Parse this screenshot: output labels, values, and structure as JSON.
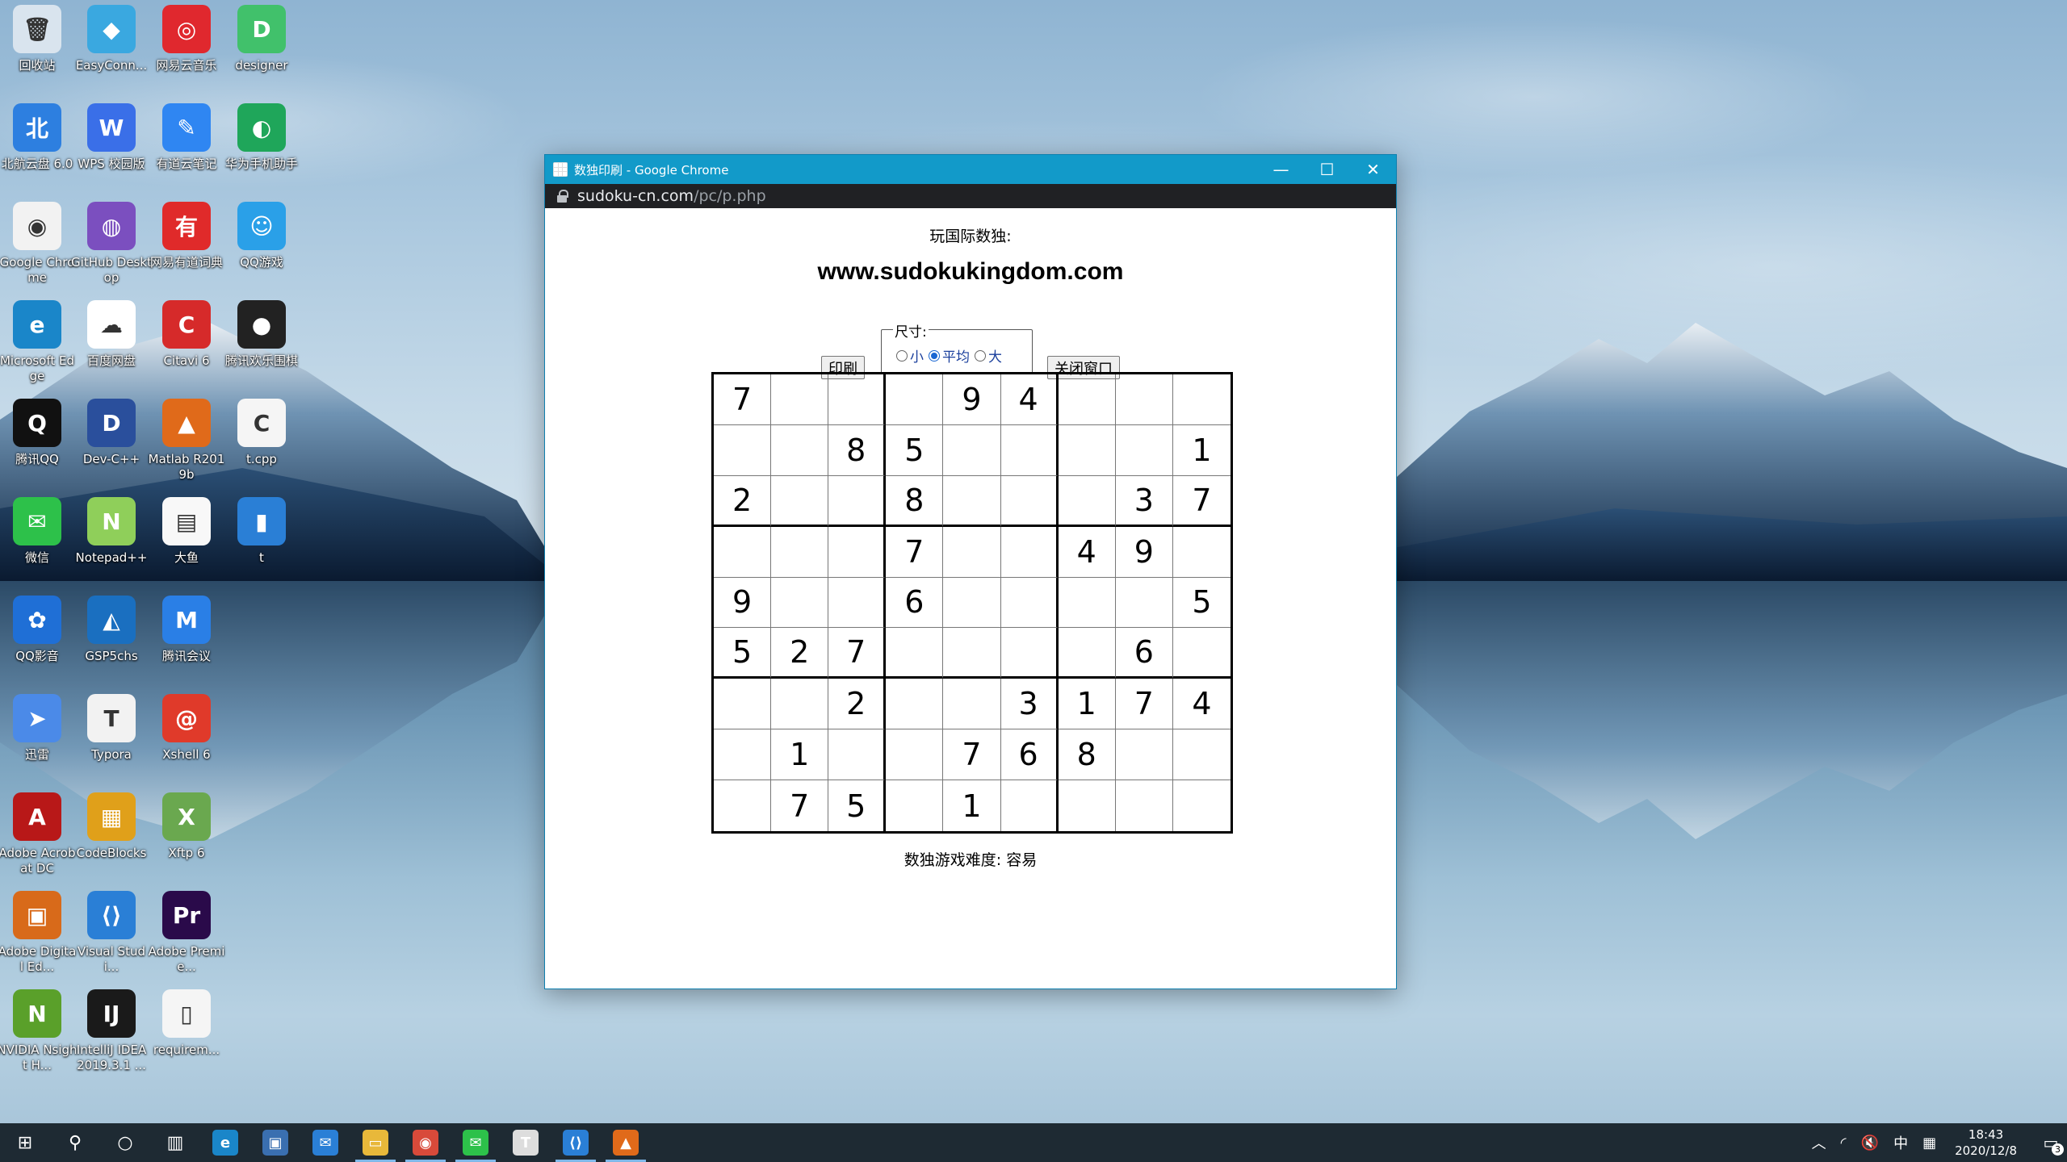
{
  "desktop": {
    "icons": [
      {
        "label": "回收站",
        "color": "#d9e4ee",
        "glyph": "🗑",
        "col": 0,
        "row": 0
      },
      {
        "label": "EasyConn...",
        "color": "#3aa8e0",
        "glyph": "◆",
        "col": 1,
        "row": 0
      },
      {
        "label": "网易云音乐",
        "color": "#e0282e",
        "glyph": "◎",
        "col": 2,
        "row": 0
      },
      {
        "label": "designer",
        "color": "#41c16b",
        "glyph": "D",
        "col": 3,
        "row": 0
      },
      {
        "label": "北航云盘 6.0",
        "color": "#2d7fe0",
        "glyph": "北",
        "col": 0,
        "row": 1
      },
      {
        "label": "WPS 校园版",
        "color": "#3a6fe8",
        "glyph": "W",
        "col": 1,
        "row": 1
      },
      {
        "label": "有道云笔记",
        "color": "#2f86f2",
        "glyph": "✎",
        "col": 2,
        "row": 1
      },
      {
        "label": "华为手机助手",
        "color": "#1fa65a",
        "glyph": "◐",
        "col": 3,
        "row": 1
      },
      {
        "label": "Google Chrome",
        "color": "#f2f2f2",
        "glyph": "◉",
        "col": 0,
        "row": 2
      },
      {
        "label": "GitHub Desktop",
        "color": "#7b4fbf",
        "glyph": "◍",
        "col": 1,
        "row": 2
      },
      {
        "label": "网易有道词典",
        "color": "#e02a2a",
        "glyph": "有",
        "col": 2,
        "row": 2
      },
      {
        "label": "QQ游戏",
        "color": "#2aa0e8",
        "glyph": "☺",
        "col": 3,
        "row": 2
      },
      {
        "label": "Microsoft Edge",
        "color": "#1a86c9",
        "glyph": "e",
        "col": 0,
        "row": 3
      },
      {
        "label": "百度网盘",
        "color": "#ffffff",
        "glyph": "☁",
        "col": 1,
        "row": 3
      },
      {
        "label": "Citavi 6",
        "color": "#d62a2a",
        "glyph": "C",
        "col": 2,
        "row": 3
      },
      {
        "label": "腾讯欢乐围棋",
        "color": "#222222",
        "glyph": "●",
        "col": 3,
        "row": 3
      },
      {
        "label": "腾讯QQ",
        "color": "#111111",
        "glyph": "Q",
        "col": 0,
        "row": 4
      },
      {
        "label": "Dev-C++",
        "color": "#2a4f9c",
        "glyph": "D",
        "col": 1,
        "row": 4
      },
      {
        "label": "Matlab R2019b",
        "color": "#e06a1a",
        "glyph": "▲",
        "col": 2,
        "row": 4
      },
      {
        "label": "t.cpp",
        "color": "#f5f5f5",
        "glyph": "C",
        "col": 3,
        "row": 4
      },
      {
        "label": "微信",
        "color": "#2dc14a",
        "glyph": "✉",
        "col": 0,
        "row": 5
      },
      {
        "label": "Notepad++",
        "color": "#8fcf5a",
        "glyph": "N",
        "col": 1,
        "row": 5
      },
      {
        "label": "大鱼",
        "color": "#f8f8f8",
        "glyph": "▤",
        "col": 2,
        "row": 5
      },
      {
        "label": "t",
        "color": "#2a7fd6",
        "glyph": "▮",
        "col": 3,
        "row": 5
      },
      {
        "label": "QQ影音",
        "color": "#1f6fd6",
        "glyph": "✿",
        "col": 0,
        "row": 6
      },
      {
        "label": "GSP5chs",
        "color": "#1a6fc0",
        "glyph": "◭",
        "col": 1,
        "row": 6
      },
      {
        "label": "腾讯会议",
        "color": "#2a7fe6",
        "glyph": "M",
        "col": 2,
        "row": 6
      },
      {
        "label": "迅雷",
        "color": "#4b8ae8",
        "glyph": "➤",
        "col": 0,
        "row": 7
      },
      {
        "label": "Typora",
        "color": "#f2f2f2",
        "glyph": "T",
        "col": 1,
        "row": 7
      },
      {
        "label": "Xshell 6",
        "color": "#e03a2a",
        "glyph": "@",
        "col": 2,
        "row": 7
      },
      {
        "label": "Adobe Acrobat DC",
        "color": "#b81818",
        "glyph": "A",
        "col": 0,
        "row": 8
      },
      {
        "label": "CodeBlocks",
        "color": "#e0a01a",
        "glyph": "▦",
        "col": 1,
        "row": 8
      },
      {
        "label": "Xftp 6",
        "color": "#6aa84f",
        "glyph": "X",
        "col": 2,
        "row": 8
      },
      {
        "label": "Adobe Digital Ed...",
        "color": "#d86a1a",
        "glyph": "▣",
        "col": 0,
        "row": 9
      },
      {
        "label": "Visual Studi...",
        "color": "#2a7fd6",
        "glyph": "⟨⟩",
        "col": 1,
        "row": 9
      },
      {
        "label": "Adobe Premie...",
        "color": "#2a0a4a",
        "glyph": "Pr",
        "col": 2,
        "row": 9
      },
      {
        "label": "NVIDIA Nsight H...",
        "color": "#5aa02a",
        "glyph": "N",
        "col": 0,
        "row": 10
      },
      {
        "label": "IntelliJ IDEA 2019.3.1 ...",
        "color": "#1a1a1a",
        "glyph": "IJ",
        "col": 1,
        "row": 10
      },
      {
        "label": "requirem...",
        "color": "#f5f5f5",
        "glyph": "▯",
        "col": 2,
        "row": 10
      }
    ]
  },
  "window": {
    "title": "数独印刷 - Google Chrome",
    "controls": {
      "minimize": "—",
      "maximize": "☐",
      "close": "✕"
    },
    "url_host": "sudoku-cn.com",
    "url_path": "/pc/p.php"
  },
  "page": {
    "intro": "玩国际数独:",
    "site": "www.sudokukingdom.com",
    "print_button": "印刷",
    "close_button": "关闭窗口",
    "size_legend": "尺寸:",
    "size_options": [
      {
        "label": "小",
        "selected": false
      },
      {
        "label": "平均",
        "selected": true
      },
      {
        "label": "大",
        "selected": false
      }
    ],
    "difficulty": "数独游戏难度: 容易",
    "sudoku": [
      [
        "7",
        "",
        "",
        "",
        "9",
        "4",
        "",
        "",
        ""
      ],
      [
        "",
        "",
        "8",
        "5",
        "",
        "",
        "",
        "",
        "1"
      ],
      [
        "2",
        "",
        "",
        "8",
        "",
        "",
        "",
        "3",
        "7"
      ],
      [
        "",
        "",
        "",
        "7",
        "",
        "",
        "4",
        "9",
        ""
      ],
      [
        "9",
        "",
        "",
        "6",
        "",
        "",
        "",
        "",
        "5"
      ],
      [
        "5",
        "2",
        "7",
        "",
        "",
        "",
        "",
        "6",
        ""
      ],
      [
        "",
        "",
        "2",
        "",
        "",
        "3",
        "1",
        "7",
        "4"
      ],
      [
        "",
        "1",
        "",
        "",
        "7",
        "6",
        "8",
        "",
        ""
      ],
      [
        "",
        "7",
        "5",
        "",
        "1",
        "",
        "",
        "",
        ""
      ]
    ]
  },
  "taskbar": {
    "apps": [
      {
        "name": "windows-start-icon",
        "glyph": "⊞",
        "color": "transparent",
        "active": false
      },
      {
        "name": "search-icon",
        "glyph": "⚲",
        "color": "transparent",
        "active": false
      },
      {
        "name": "cortana-icon",
        "glyph": "○",
        "color": "transparent",
        "active": false
      },
      {
        "name": "task-view-icon",
        "glyph": "▥",
        "color": "transparent",
        "active": false
      },
      {
        "name": "edge-icon",
        "glyph": "e",
        "color": "#1a86c9",
        "active": false
      },
      {
        "name": "store-icon",
        "glyph": "▣",
        "color": "#3a6fb0",
        "active": false
      },
      {
        "name": "mail-icon",
        "glyph": "✉",
        "color": "#2a7fd6",
        "active": false
      },
      {
        "name": "file-explorer-icon",
        "glyph": "▭",
        "color": "#e8b83a",
        "active": true
      },
      {
        "name": "chrome-icon",
        "glyph": "◉",
        "color": "#d84a3a",
        "active": true
      },
      {
        "name": "wechat-icon",
        "glyph": "✉",
        "color": "#2dc14a",
        "active": true
      },
      {
        "name": "typora-icon",
        "glyph": "T",
        "color": "#dddddd",
        "active": false
      },
      {
        "name": "vscode-icon",
        "glyph": "⟨⟩",
        "color": "#2a7fd6",
        "active": true
      },
      {
        "name": "matlab-icon",
        "glyph": "▲",
        "color": "#e06a1a",
        "active": true
      }
    ],
    "tray": {
      "chevron": "︿",
      "network": "◜",
      "volume": "🔇",
      "ime": "中",
      "ime_mode": "▦",
      "time": "18:43",
      "date": "2020/12/8",
      "notification_count": "3"
    }
  }
}
